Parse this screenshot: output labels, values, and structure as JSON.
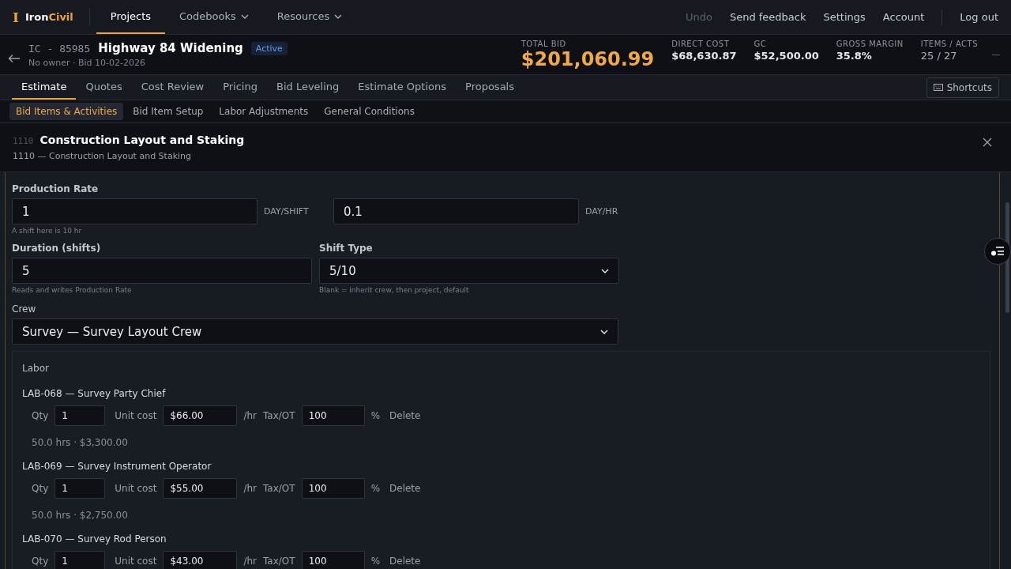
{
  "app": {
    "logo": "I",
    "brand_first": "Iron",
    "brand_second": "Civil"
  },
  "nav": [
    {
      "label": "Projects",
      "selected": true,
      "dropdown": false
    },
    {
      "label": "Codebooks",
      "selected": false,
      "dropdown": true
    },
    {
      "label": "Resources",
      "selected": false,
      "dropdown": true
    }
  ],
  "top_actions": [
    {
      "label": "Undo",
      "disabled": true
    },
    {
      "label": "Send feedback",
      "disabled": false
    },
    {
      "label": "Settings",
      "disabled": false
    },
    {
      "label": "Account",
      "disabled": false
    },
    {
      "label": "Log out",
      "disabled": false
    }
  ],
  "project": {
    "code": "IC - 85985",
    "name": "Highway 84 Widening",
    "status": "Active",
    "meta": "No owner · Bid 10-02-2026"
  },
  "stats": [
    {
      "label": "TOTAL BID",
      "value": "$201,060.99",
      "kind": "total"
    },
    {
      "label": "DIRECT COST",
      "value": "$68,630.87",
      "kind": "money"
    },
    {
      "label": "GC",
      "value": "$52,500.00",
      "kind": "money"
    },
    {
      "label": "GROSS MARGIN",
      "value": "35.8%",
      "kind": "money"
    },
    {
      "label": "ITEMS / ACTS",
      "value": "25 / 27",
      "kind": "count"
    }
  ],
  "tabs": [
    {
      "label": "Estimate",
      "selected": true
    },
    {
      "label": "Quotes",
      "selected": false
    },
    {
      "label": "Cost Review",
      "selected": false
    },
    {
      "label": "Pricing",
      "selected": false
    },
    {
      "label": "Bid Leveling",
      "selected": false
    },
    {
      "label": "Estimate Options",
      "selected": false
    },
    {
      "label": "Proposals",
      "selected": false
    }
  ],
  "shortcuts_button": "Shortcuts",
  "subtabs": [
    {
      "label": "Bid Items & Activities",
      "selected": true
    },
    {
      "label": "Bid Item Setup",
      "selected": false
    },
    {
      "label": "Labor Adjustments",
      "selected": false
    },
    {
      "label": "General Conditions",
      "selected": false
    }
  ],
  "detail": {
    "code": "1110",
    "title": "Construction Layout and Staking",
    "subtitle": "1110 — Construction Layout and Staking",
    "production_rate": {
      "label": "Production Rate",
      "value": "1",
      "unit": "DAY/SHIFT",
      "value_2": "0.1",
      "unit_2": "DAY/HR",
      "hint": "A shift here is 10 hr"
    },
    "duration": {
      "label": "Duration (shifts)",
      "value": "5",
      "hint": "Reads and writes Production Rate"
    },
    "shift_type": {
      "label": "Shift Type",
      "value": "5/10",
      "hint": "Blank = inherit crew, then project, default"
    },
    "crew": {
      "label": "Crew",
      "value": "Survey — Survey Layout Crew"
    },
    "labor": {
      "title": "Labor",
      "items": [
        {
          "name": "LAB-068 — Survey Party Chief",
          "qty_label": "Qty",
          "qty": "1",
          "unit_cost_label": "Unit cost",
          "unit_cost": "$66.00",
          "per": "/hr",
          "tax_label": "Tax/OT",
          "tax_ot": "100",
          "pct": "%",
          "delete": "Delete",
          "summary": "50.0 hrs · $3,300.00"
        },
        {
          "name": "LAB-069 — Survey Instrument Operator",
          "qty_label": "Qty",
          "qty": "1",
          "unit_cost_label": "Unit cost",
          "unit_cost": "$55.00",
          "per": "/hr",
          "tax_label": "Tax/OT",
          "tax_ot": "100",
          "pct": "%",
          "delete": "Delete",
          "summary": "50.0 hrs · $2,750.00"
        },
        {
          "name": "LAB-070 — Survey Rod Person",
          "qty_label": "Qty",
          "qty": "1",
          "unit_cost_label": "Unit cost",
          "unit_cost": "$43.00",
          "per": "/hr",
          "tax_label": "Tax/OT",
          "tax_ot": "100",
          "pct": "%",
          "delete": "Delete"
        }
      ]
    }
  }
}
